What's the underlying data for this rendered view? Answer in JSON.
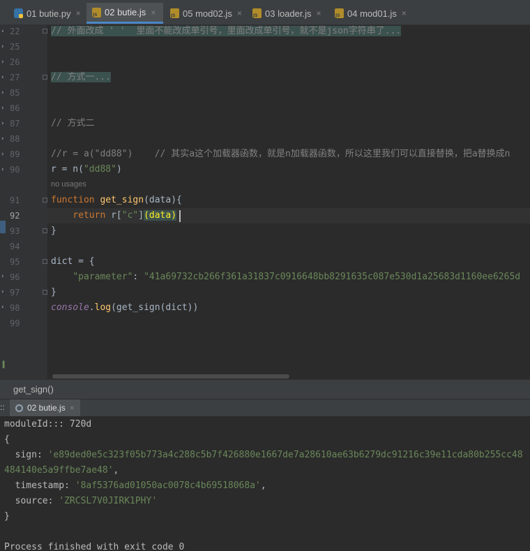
{
  "tabs": [
    {
      "label": "01 butie.py",
      "icon": "python-file-icon",
      "active": false
    },
    {
      "label": "02 butie.js",
      "icon": "js-file-icon",
      "active": true
    },
    {
      "label": "05 mod02.js",
      "icon": "js-file-icon",
      "active": false
    },
    {
      "label": "03 loader.js",
      "icon": "js-file-icon",
      "active": false
    },
    {
      "label": "04 mod01.js",
      "icon": "js-file-icon",
      "active": false
    }
  ],
  "close_glyph": "×",
  "editor": {
    "line_numbers": [
      "22",
      "25",
      "26",
      "27",
      "85",
      "86",
      "87",
      "88",
      "89",
      "90",
      "91",
      "92",
      "93",
      "94",
      "95",
      "96",
      "97",
      "98",
      "99"
    ],
    "current_line": "92",
    "hint_no_usages": "no usages",
    "lines": {
      "l22": "// 外面改成 ' '  里面不能改成单引号，里面改成单引号，就不是json字符串了...",
      "l27": "// 方式一...",
      "l87": "// 方式二",
      "l89_code": "//r = a(\"dd88\")",
      "l89_comment": "// 其实a这个加载器函数，就是n加载器函数，所以这里我们可以直接替换，把a替换成n",
      "l90_a": "r = n(",
      "l90_str": "\"dd88\"",
      "l90_b": ")",
      "l91_kw": "function",
      "l91_fn": "get_sign",
      "l91_rest": "(data){",
      "l92_kw": "return",
      "l92_a": " r[",
      "l92_str": "\"c\"",
      "l92_b": "]",
      "l92_c": "(data)",
      "l93": "}",
      "l95": "dict = {",
      "l96_key": "\"parameter\"",
      "l96_colon": ": ",
      "l96_val": "\"41a69732cb266f361a31837c0916648bb8291635c087e530d1a25683d1160ee6265d",
      "l97": "}",
      "l98_obj": "console",
      "l98_dot": ".",
      "l98_fn": "log",
      "l98_rest": "(get_sign(dict))"
    }
  },
  "breadcrumb": {
    "label": "get_sign()"
  },
  "run": {
    "label": "::",
    "tab_label": "02 butie.js"
  },
  "console": {
    "module_id": "moduleId::: 720d",
    "open_brace": "{",
    "sign_key": "  sign: ",
    "sign_value_1": "'e89ded0e5c323f05b773a4c288c5b7f426880e1667de7a28610ae63b6279dc91216c39e11cda80b255cc48",
    "sign_value_2": "484140e5a9ffbe7ae48'",
    "sign_comma": ",",
    "timestamp_key": "  timestamp: ",
    "timestamp_value": "'8af5376ad01050ac0078c4b69518068a'",
    "timestamp_comma": ",",
    "source_key": "  source: ",
    "source_value": "'ZRCSL7V0JIRK1PHY'",
    "close_brace": "}",
    "exit_message": "Process finished with exit code 0"
  }
}
